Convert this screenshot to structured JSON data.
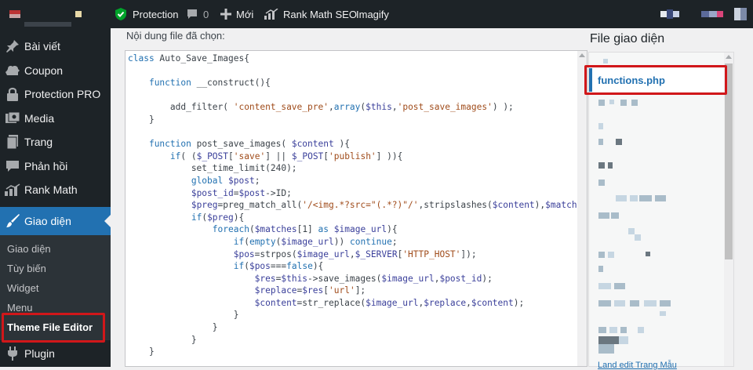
{
  "admin_bar": {
    "protection": "Protection",
    "comments_count": "0",
    "new_label": "Mới",
    "rank_math": "Rank Math SEO",
    "imagify": "Imagify"
  },
  "sidebar": {
    "items": [
      {
        "label": "Bài viết",
        "icon": "pin-icon"
      },
      {
        "label": "Coupon",
        "icon": "coupon-icon"
      },
      {
        "label": "Protection PRO",
        "icon": "lock-icon"
      },
      {
        "label": "Media",
        "icon": "media-icon"
      },
      {
        "label": "Trang",
        "icon": "page-icon"
      },
      {
        "label": "Phản hồi",
        "icon": "comment-icon"
      },
      {
        "label": "Rank Math",
        "icon": "chart-icon"
      },
      {
        "label": "Giao diện",
        "icon": "brush-icon"
      },
      {
        "label": "Plugin",
        "icon": "plug-icon"
      }
    ],
    "submenu": [
      "Giao diện",
      "Tùy biến",
      "Widget",
      "Menu",
      "Theme File Editor"
    ]
  },
  "editor": {
    "label": "Nội dung file đã chọn:",
    "code_lines": [
      "class Auto_Save_Images{",
      "",
      "    function __construct(){",
      "",
      "        add_filter( 'content_save_pre',array($this,'post_save_images') );",
      "    }",
      "",
      "    function post_save_images( $content ){",
      "        if( ($_POST['save'] || $_POST['publish'] )){",
      "            set_time_limit(240);",
      "            global $post;",
      "            $post_id=$post->ID;",
      "            $preg=preg_match_all('/<img.*?src=\"(.*?)\"/',stripslashes($content),$matches);",
      "            if($preg){",
      "                foreach($matches[1] as $image_url){",
      "                    if(empty($image_url)) continue;",
      "                    $pos=strpos($image_url,$_SERVER['HTTP_HOST']);",
      "                    if($pos===false){",
      "                        $res=$this->save_images($image_url,$post_id);",
      "                        $replace=$res['url'];",
      "                        $content=str_replace($image_url,$replace,$content);",
      "                    }",
      "                }",
      "            }",
      "    }"
    ]
  },
  "files_panel": {
    "title": "File giao diện",
    "current_file": "functions.php",
    "footer_link": "Land edit Trang Mẫu"
  },
  "colors": {
    "admin_bg": "#1d2327",
    "accent": "#2271b1",
    "callout": "#d1171a"
  }
}
